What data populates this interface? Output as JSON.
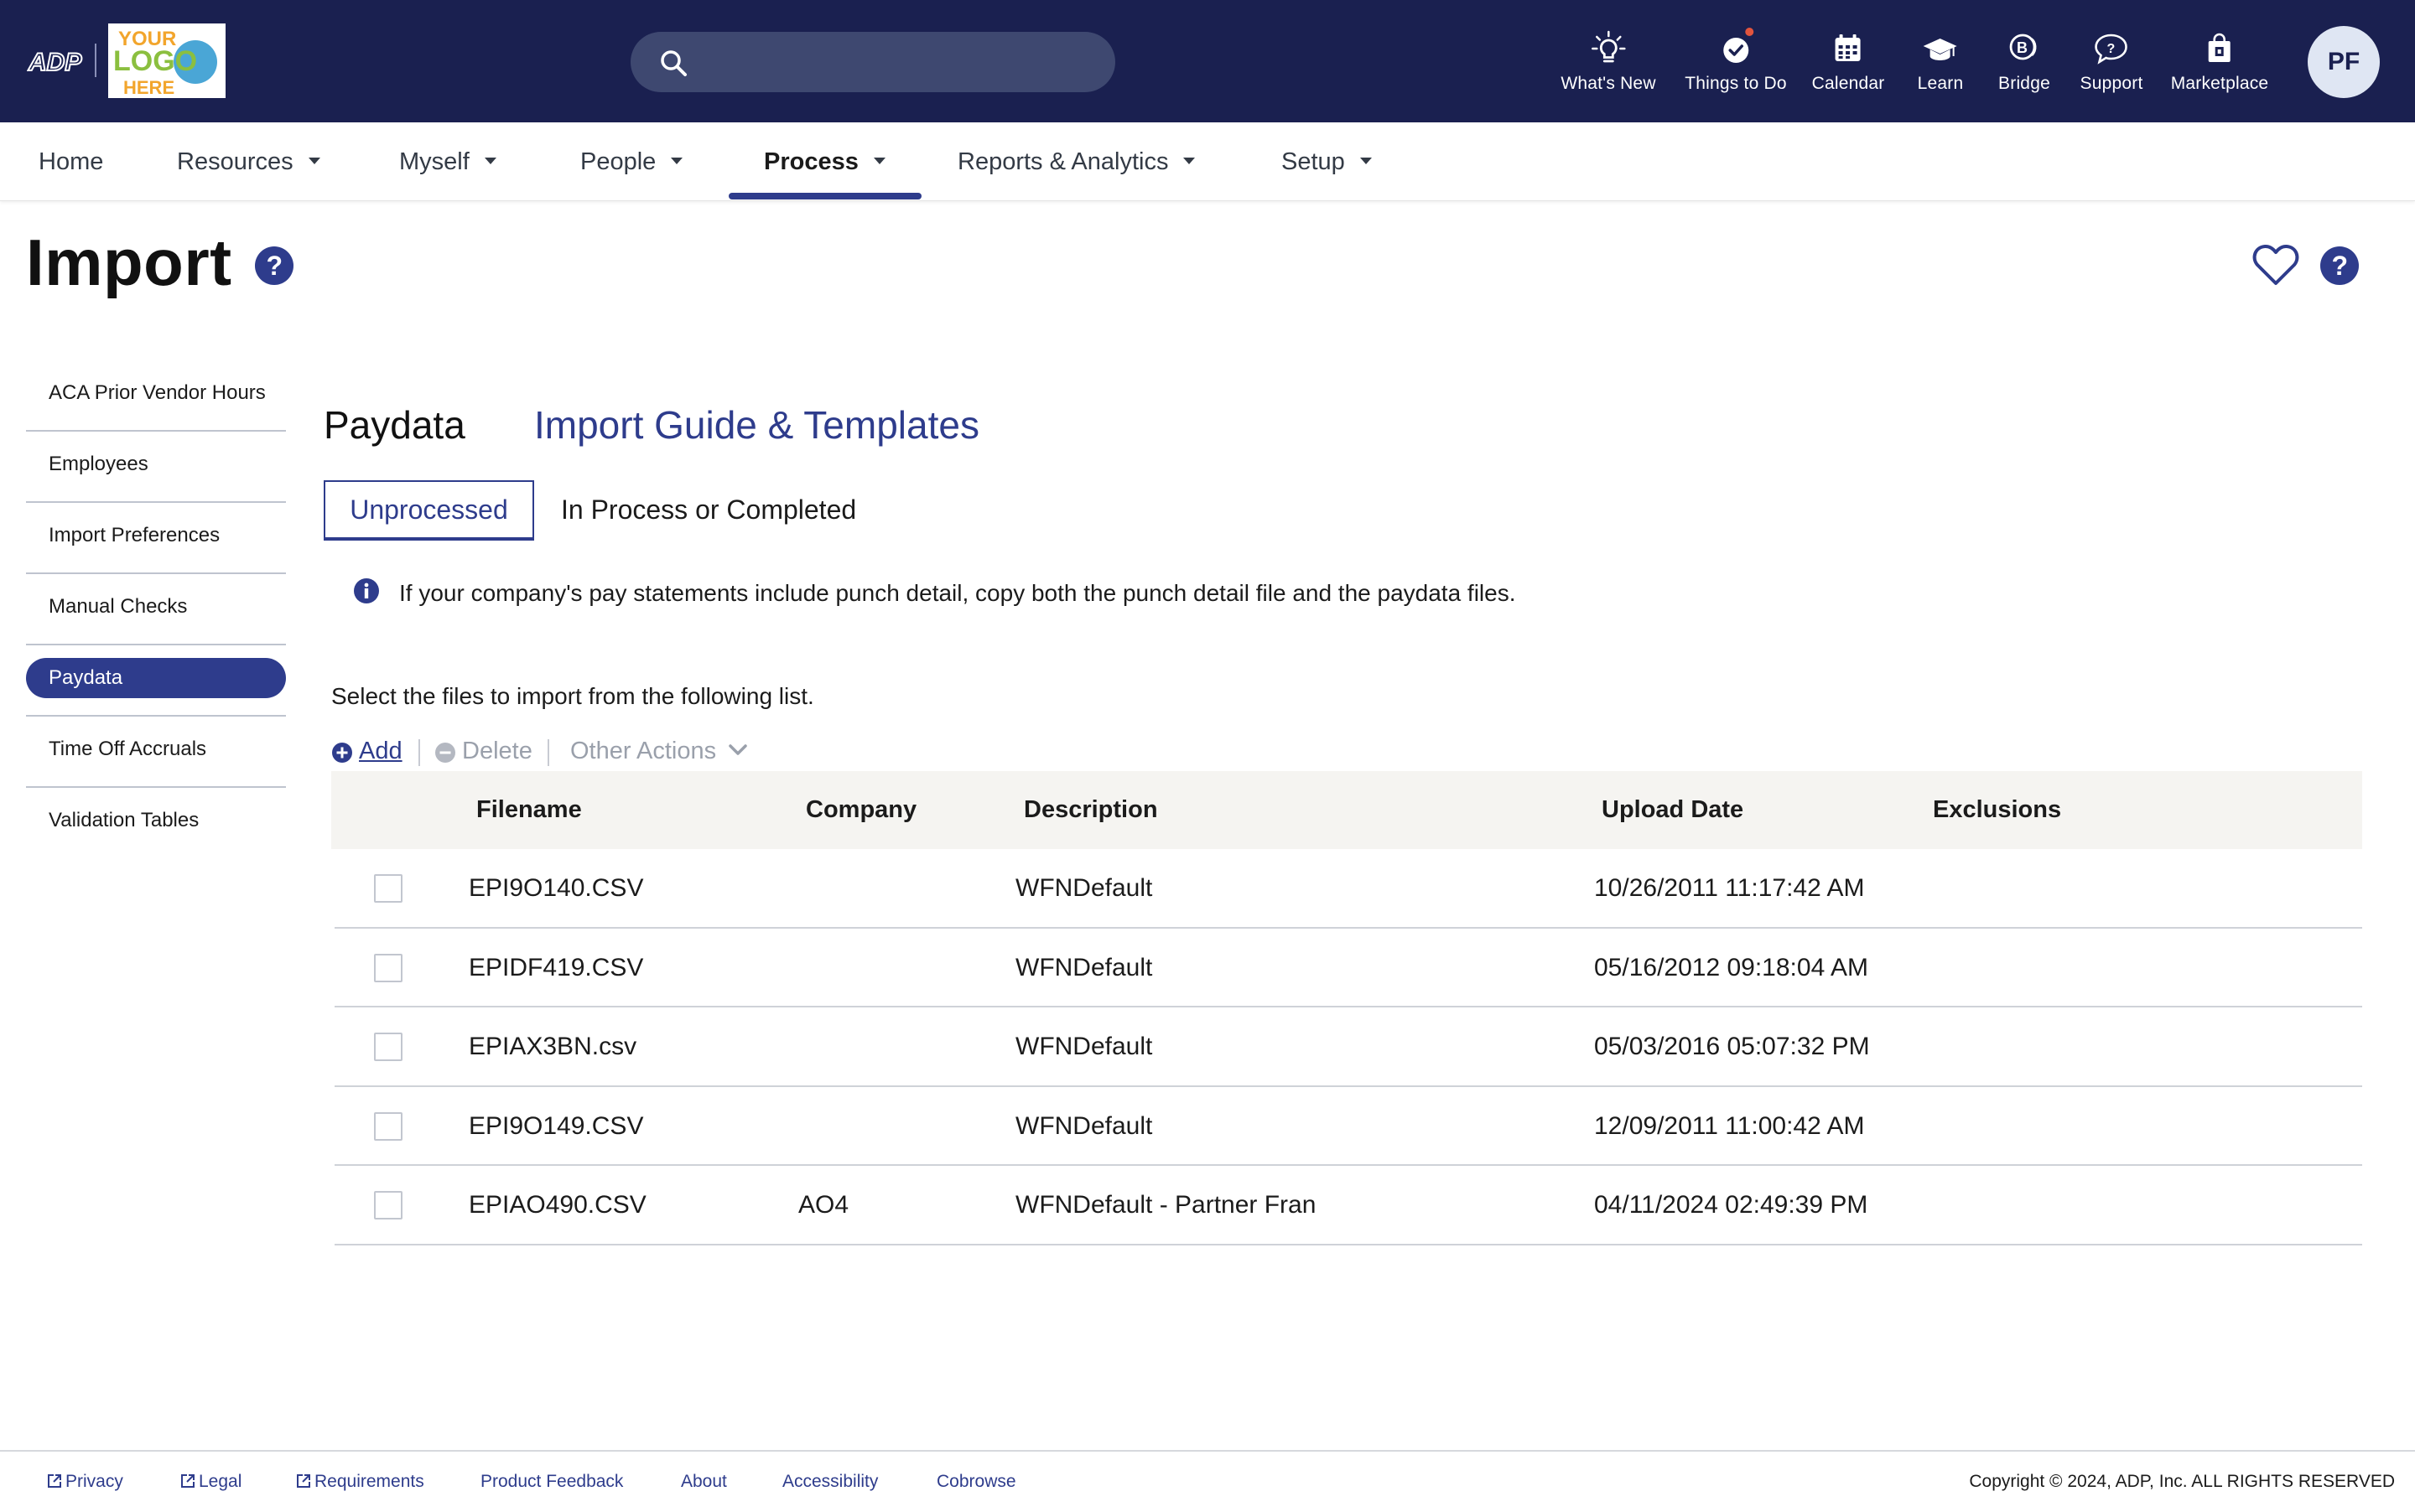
{
  "header": {
    "adp_logo_text": "ADP",
    "brand_logo_text": [
      "YOUR",
      "LOGO",
      "HERE"
    ],
    "search_placeholder": "",
    "icons": [
      {
        "label": "What's New",
        "icon": "lightbulb-icon"
      },
      {
        "label": "Things to Do",
        "icon": "check-circle-icon",
        "has_notification": true
      },
      {
        "label": "Calendar",
        "icon": "calendar-icon"
      },
      {
        "label": "Learn",
        "icon": "graduation-cap-icon"
      },
      {
        "label": "Bridge",
        "icon": "bridge-icon"
      },
      {
        "label": "Support",
        "icon": "chat-question-icon"
      },
      {
        "label": "Marketplace",
        "icon": "shopping-bag-icon"
      }
    ],
    "avatar_initials": "PF"
  },
  "nav": {
    "items": [
      {
        "label": "Home",
        "has_caret": false
      },
      {
        "label": "Resources",
        "has_caret": true
      },
      {
        "label": "Myself",
        "has_caret": true
      },
      {
        "label": "People",
        "has_caret": true
      },
      {
        "label": "Process",
        "has_caret": true,
        "active": true
      },
      {
        "label": "Reports & Analytics",
        "has_caret": true
      },
      {
        "label": "Setup",
        "has_caret": true
      }
    ]
  },
  "page": {
    "title": "Import"
  },
  "sidebar": {
    "items": [
      {
        "label": "ACA Prior Vendor Hours"
      },
      {
        "label": "Employees"
      },
      {
        "label": "Import Preferences"
      },
      {
        "label": "Manual Checks"
      },
      {
        "label": "Paydata",
        "active": true
      },
      {
        "label": "Time Off Accruals"
      },
      {
        "label": "Validation Tables"
      }
    ]
  },
  "content": {
    "section_title": "Paydata",
    "guide_link": "Import Guide & Templates",
    "tabs": [
      {
        "label": "Unprocessed",
        "active": true
      },
      {
        "label": "In Process or Completed"
      }
    ],
    "info_text": "If your company's pay statements include punch detail, copy both the punch detail file and the paydata files.",
    "select_text": "Select the files to import from the following list.",
    "toolbar": {
      "add_label": "Add",
      "delete_label": "Delete",
      "other_actions_label": "Other Actions"
    },
    "table": {
      "columns": [
        "Filename",
        "Company",
        "Description",
        "Upload Date",
        "Exclusions"
      ],
      "rows": [
        {
          "filename": "EPI9O140.CSV",
          "company": "",
          "description": "WFNDefault",
          "upload_date": "10/26/2011 11:17:42 AM",
          "exclusions": ""
        },
        {
          "filename": "EPIDF419.CSV",
          "company": "",
          "description": "WFNDefault",
          "upload_date": "05/16/2012 09:18:04 AM",
          "exclusions": ""
        },
        {
          "filename": "EPIAX3BN.csv",
          "company": "",
          "description": "WFNDefault",
          "upload_date": "05/03/2016 05:07:32 PM",
          "exclusions": ""
        },
        {
          "filename": "EPI9O149.CSV",
          "company": "",
          "description": "WFNDefault",
          "upload_date": "12/09/2011 11:00:42 AM",
          "exclusions": ""
        },
        {
          "filename": "EPIAO490.CSV",
          "company": "AO4",
          "description": "WFNDefault - Partner Fran",
          "upload_date": "04/11/2024 02:49:39 PM",
          "exclusions": ""
        }
      ]
    }
  },
  "footer": {
    "links": [
      {
        "label": "Privacy",
        "external": true
      },
      {
        "label": "Legal",
        "external": true
      },
      {
        "label": "Requirements",
        "external": true
      },
      {
        "label": "Product Feedback",
        "external": false
      },
      {
        "label": "About",
        "external": false
      },
      {
        "label": "Accessibility",
        "external": false
      },
      {
        "label": "Cobrowse",
        "external": false
      }
    ],
    "copyright": "Copyright © 2024, ADP, Inc. ALL RIGHTS RESERVED"
  },
  "colors": {
    "header_bg": "#1a2050",
    "accent": "#2e3c8c",
    "search_bg": "#3e4870",
    "notification": "#e2543d",
    "table_header_bg": "#f5f4f1"
  }
}
